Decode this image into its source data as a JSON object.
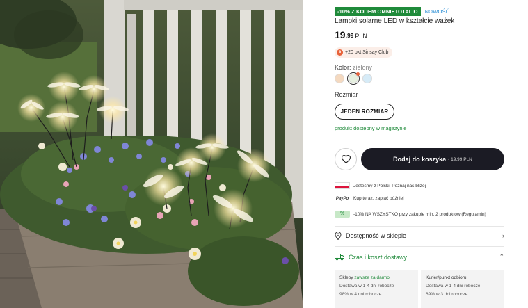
{
  "badges": {
    "promo": "-10% Z KODEM OMNIETOTALIO",
    "new": "NOWOŚĆ"
  },
  "product": {
    "title": "Lampki solarne LED w kształcie ważek",
    "price_int": "19",
    "price_dec": ",99",
    "currency": "PLN"
  },
  "club": {
    "icon": "sinsay-club-icon",
    "text": "+20 pkt Sinsay Club"
  },
  "color": {
    "label": "Kolor:",
    "value": "zielony",
    "swatches": [
      "#f4d9c0",
      "#e6f0e0",
      "#d6ebf7"
    ]
  },
  "size": {
    "label": "Rozmiar",
    "button": "JEDEN ROZMIAR"
  },
  "stock": "produkt dostępny w magazynie",
  "cart": {
    "label": "Dodaj do koszyka",
    "price": "- 19,99 PLN"
  },
  "info": [
    {
      "icon": "poland-flag-icon",
      "text": "Jesteśmy z Polski! Poznaj nas bliżej"
    },
    {
      "icon": "paypo-icon",
      "badge": "PayPo",
      "text": "Kup teraz, zapłać później"
    },
    {
      "icon": "discount-tag-icon",
      "text": "-10% NA WSZYSTKO przy zakupie min. 2 produktów (Regulamin)"
    }
  ],
  "availability": {
    "label": "Dostępność w sklepie",
    "icon": "location-pin-icon"
  },
  "shipping": {
    "label": "Czas i koszt dostawy",
    "icon": "delivery-truck-icon"
  },
  "delivery": [
    {
      "head": "Sklepy",
      "free": "zawsze za darmo",
      "line1": "Dostawa w 1-4 dni robocze",
      "line2": "98% w 4 dni robocze"
    },
    {
      "head": "Kurier/punkt odbioru",
      "free": "",
      "line1": "Dostawa w 1-4 dni robocze",
      "line2": "69% w 3 dni robocze"
    }
  ],
  "colors": {
    "accent_green": "#1f8a3a",
    "new_blue": "#2b8fd6",
    "cart_bg": "#1b1b24"
  }
}
